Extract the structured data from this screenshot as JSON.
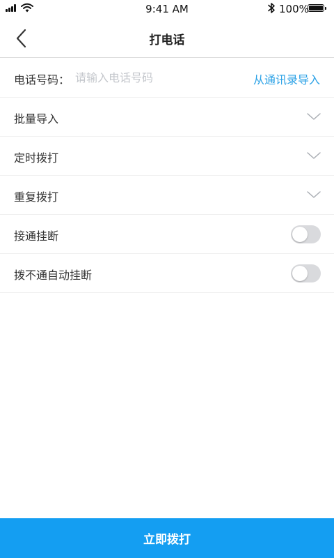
{
  "status_bar": {
    "time": "9:41 AM",
    "battery_percent": "100%",
    "battery_level": 1.0,
    "icons": [
      "signal-icon",
      "wifi-icon",
      "bluetooth-icon",
      "battery-icon"
    ]
  },
  "nav": {
    "title": "打电话",
    "back_icon": "chevron-left-icon"
  },
  "phone": {
    "label": "电话号码：",
    "placeholder": "请输入电话号码",
    "value": "",
    "import_link": "从通讯录导入"
  },
  "rows": [
    {
      "label": "批量导入",
      "control": "dropdown",
      "icon": "chevron-down-icon"
    },
    {
      "label": "定时拨打",
      "control": "dropdown",
      "icon": "chevron-down-icon"
    },
    {
      "label": "重复拨打",
      "control": "dropdown",
      "icon": "chevron-down-icon"
    },
    {
      "label": "接通挂断",
      "control": "toggle",
      "on": false
    },
    {
      "label": "拨不通自动挂断",
      "control": "toggle",
      "on": false
    }
  ],
  "footer": {
    "call_button": "立即拨打"
  },
  "colors": {
    "accent": "#149ef2",
    "link": "#2aa1e6",
    "toggle_off": "#d9dadd",
    "placeholder": "#c4c7cc"
  }
}
